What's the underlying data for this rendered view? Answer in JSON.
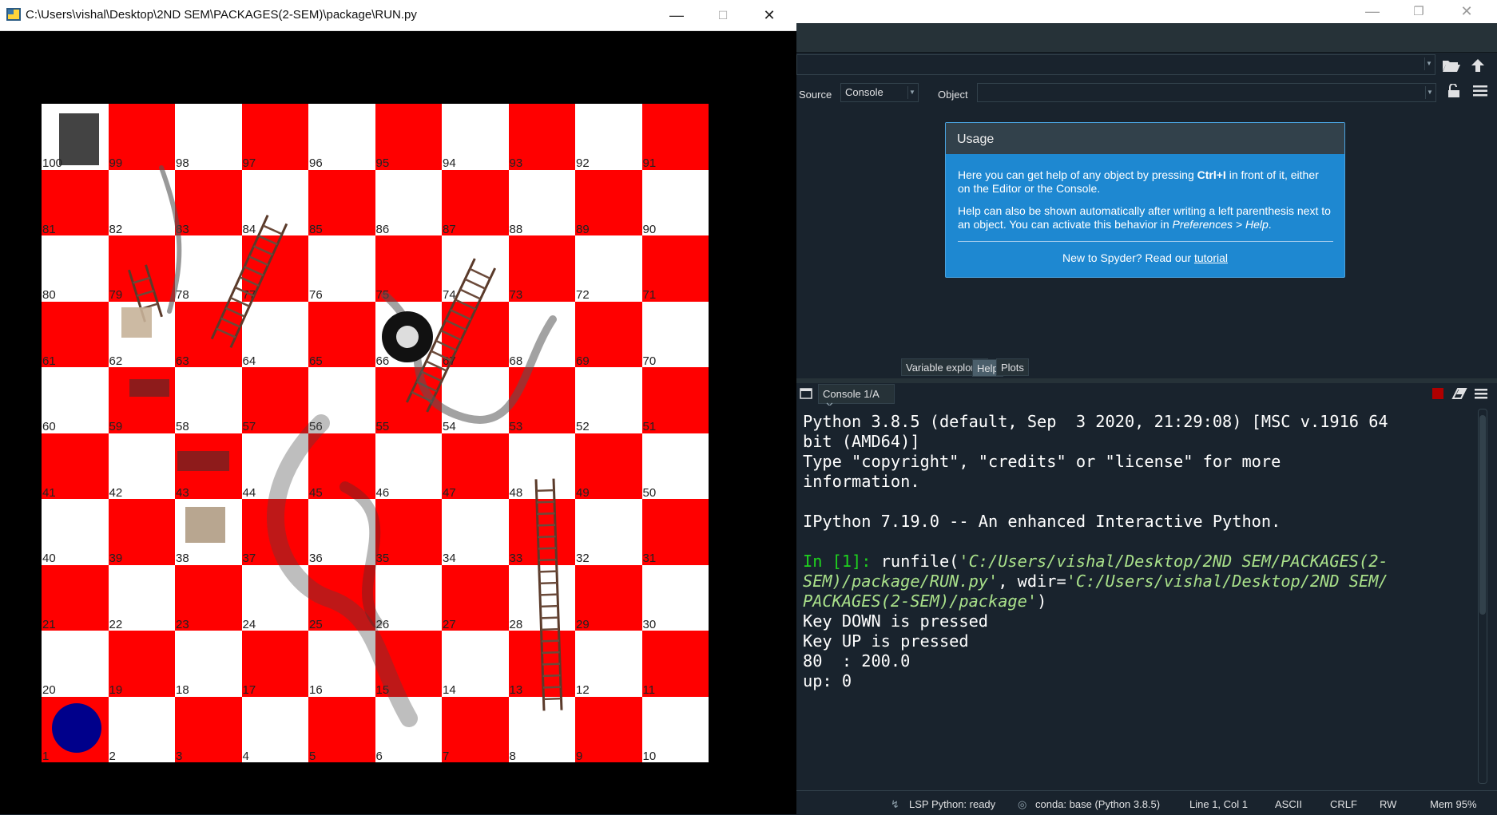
{
  "game_window": {
    "title": "C:\\Users\\vishal\\Desktop\\2ND SEM\\PACKAGES(2-SEM)\\package\\RUN.py",
    "buttons": {
      "minimize": "—",
      "maximize": "☐",
      "close": "✕"
    },
    "board": {
      "rows": [
        [
          100,
          99,
          98,
          97,
          96,
          95,
          94,
          93,
          92,
          91
        ],
        [
          81,
          82,
          83,
          84,
          85,
          86,
          87,
          88,
          89,
          90
        ],
        [
          80,
          79,
          78,
          77,
          76,
          75,
          74,
          73,
          72,
          71
        ],
        [
          61,
          62,
          63,
          64,
          65,
          66,
          67,
          68,
          69,
          70
        ],
        [
          60,
          59,
          58,
          57,
          56,
          55,
          54,
          53,
          52,
          51
        ],
        [
          41,
          42,
          43,
          44,
          45,
          46,
          47,
          48,
          49,
          50
        ],
        [
          40,
          39,
          38,
          37,
          36,
          35,
          34,
          33,
          32,
          31
        ],
        [
          21,
          22,
          23,
          24,
          25,
          26,
          27,
          28,
          29,
          30
        ],
        [
          20,
          19,
          18,
          17,
          16,
          15,
          14,
          13,
          12,
          11
        ],
        [
          1,
          2,
          3,
          4,
          5,
          6,
          7,
          8,
          9,
          10
        ]
      ],
      "colors": {
        "red": "#ff0000",
        "white": "#ffffff",
        "player_token": "#00008b"
      }
    }
  },
  "spyder": {
    "window_buttons": {
      "minimize": "—",
      "restore": "❐",
      "close": "✕"
    },
    "help_pane": {
      "source_label": "Source",
      "source_value": "Console",
      "object_label": "Object",
      "usage": {
        "title": "Usage",
        "p1_a": "Here you can get help of any object by pressing ",
        "p1_key": "Ctrl+I",
        "p1_b": " in front of it, either on the Editor or the Console.",
        "p2_a": "Help can also be shown automatically after writing a left parenthesis next to an object. You can activate this behavior in ",
        "p2_em": "Preferences > Help",
        "p2_b": ".",
        "footer_text": "New to Spyder? Read our ",
        "footer_link": "tutorial"
      }
    },
    "pane_tabs": [
      "Variable explorer",
      "Help",
      "Plots"
    ],
    "console": {
      "tab_label": "Console 1/A",
      "lines": {
        "l1": "Python 3.8.5 (default, Sep  3 2020, 21:29:08) [MSC v.1916 64",
        "l2": "bit (AMD64)]",
        "l3": "Type \"copyright\", \"credits\" or \"license\" for more",
        "l4": "information.",
        "l5": "IPython 7.19.0 -- An enhanced Interactive Python.",
        "prompt": "In [1]: ",
        "cmd_a": "runfile(",
        "cmd_s1": "'C:/Users/vishal/Desktop/2ND SEM/PACKAGES(2-\nSEM)/package/RUN.py'",
        "cmd_b": ", wdir=",
        "cmd_s2": "'C:/Users/vishal/Desktop/2ND SEM/\nPACKAGES(2-SEM)/package'",
        "cmd_c": ")",
        "o1": "Key DOWN is pressed",
        "o2": "Key UP is pressed",
        "o3": "80  : 200.0",
        "o4": "up: 0"
      }
    },
    "status": {
      "lsp": "LSP Python: ready",
      "conda": "conda: base (Python 3.8.5)",
      "position": "Line 1, Col 1",
      "encoding": "ASCII",
      "eol": "CRLF",
      "mode": "RW",
      "mem": "Mem 95%"
    }
  }
}
